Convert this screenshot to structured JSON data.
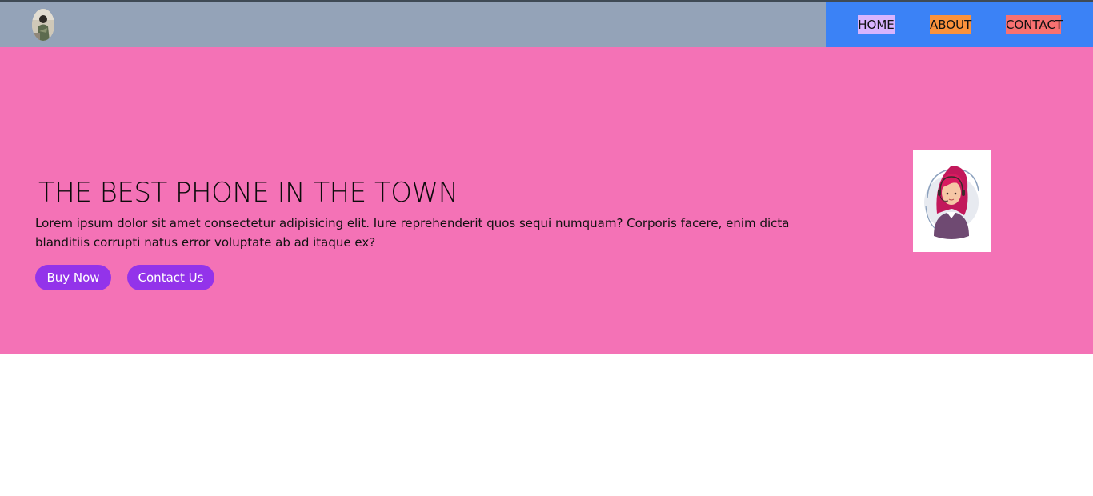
{
  "nav": {
    "logo_icon": "profile-photo",
    "links": [
      {
        "label": "HOME",
        "bg": "#d8b4fe"
      },
      {
        "label": "ABOUT",
        "bg": "#fb923c"
      },
      {
        "label": "CONTACT",
        "bg": "#f87171"
      }
    ],
    "bg_left": "#94a3b8",
    "bg_right": "#3b82f6"
  },
  "hero": {
    "title": "THE BEST PHONE IN THE TOWN",
    "description": "Lorem ipsum dolor sit amet consectetur adipisicing elit. Iure reprehenderit quos sequi numquam? Corporis facere, enim dicta blanditiis corrupti natus error voluptate ab ad itaque ex?",
    "buttons": {
      "buy_now": "Buy Now",
      "contact_us": "Contact Us"
    },
    "bg": "#f472b6",
    "button_color": "#9333ea",
    "image_icon": "support-agent-illustration"
  }
}
